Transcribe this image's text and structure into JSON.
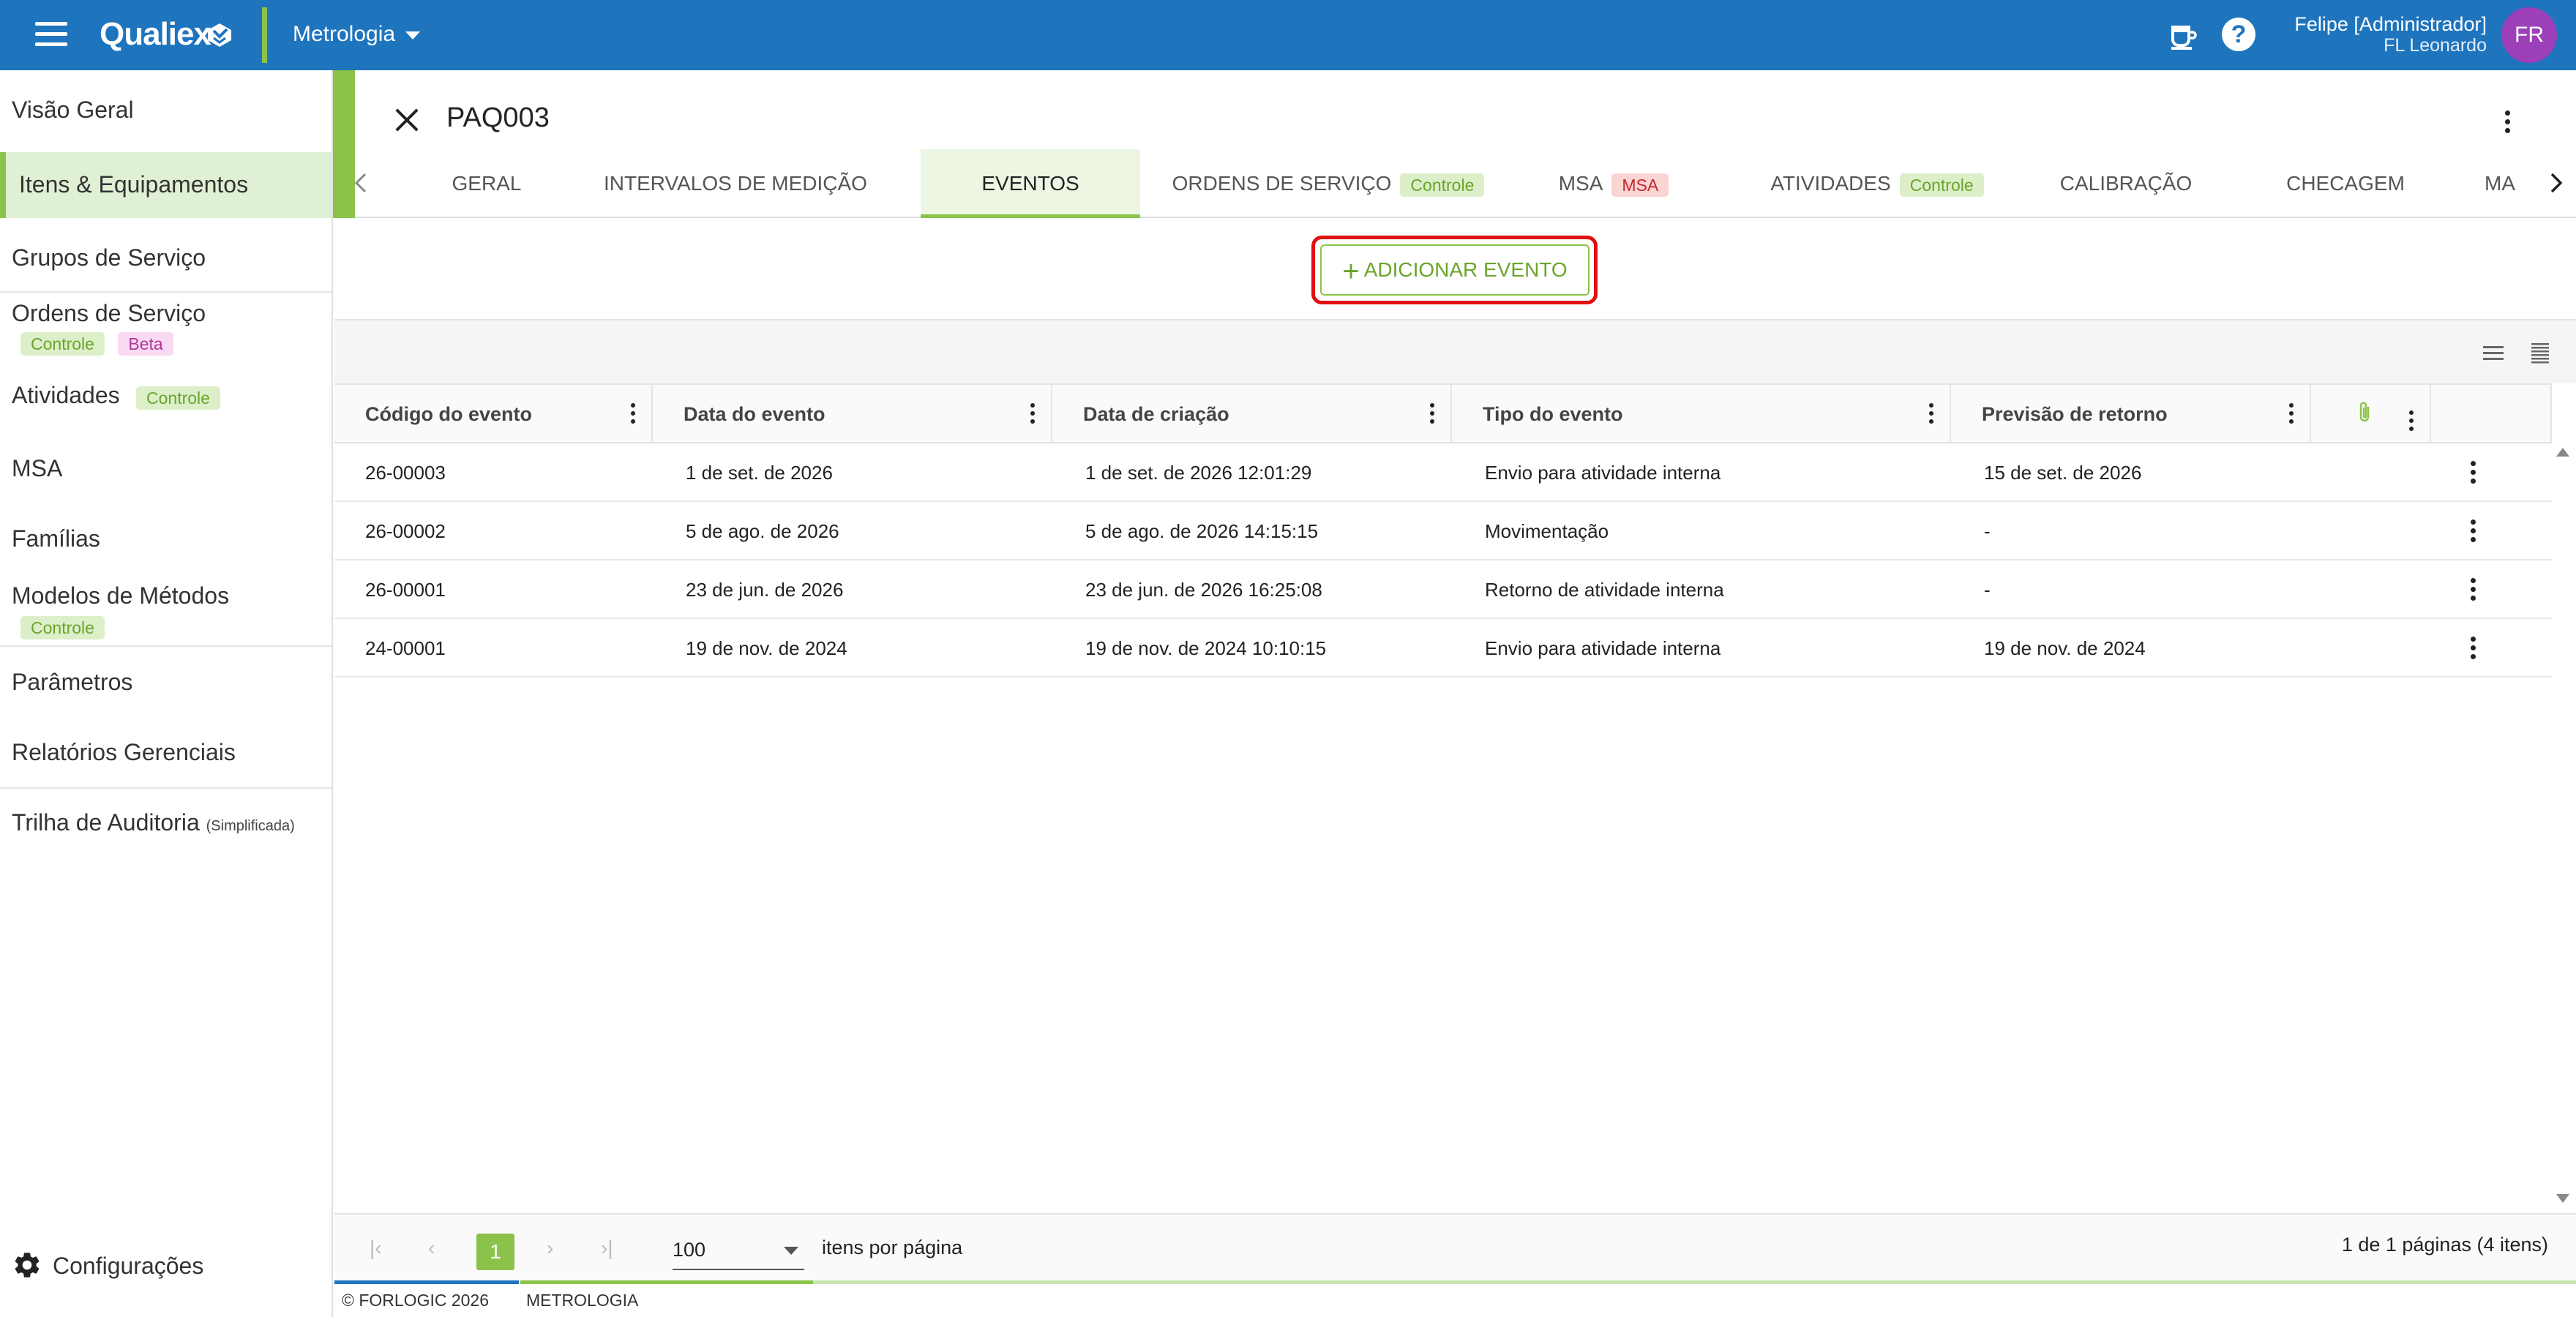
{
  "topbar": {
    "brand": "Qualiex",
    "module": "Metrologia",
    "user_name": "Felipe [Administrador]",
    "user_org": "FL Leonardo",
    "avatar_initials": "FR",
    "help_glyph": "?",
    "colors": {
      "bar": "#1e74bd",
      "accent": "#8bc34a",
      "avatar": "#9c3fb8"
    }
  },
  "sidebar": {
    "items": [
      {
        "label": "Visão Geral"
      },
      {
        "label": "Itens & Equipamentos"
      },
      {
        "label": "Grupos de Serviço"
      },
      {
        "label": "Ordens de Serviço",
        "badges": [
          "Controle",
          "Beta"
        ]
      },
      {
        "label": "Atividades",
        "badges": [
          "Controle"
        ]
      },
      {
        "label": "MSA"
      },
      {
        "label": "Famílias"
      },
      {
        "label": "Modelos de Métodos",
        "badges": [
          "Controle"
        ]
      },
      {
        "label": "Parâmetros"
      },
      {
        "label": "Relatórios Gerenciais"
      },
      {
        "label": "Trilha de Auditoria",
        "note": "(Simplificada)"
      }
    ],
    "config_label": "Configurações"
  },
  "detail": {
    "title": "PAQ003",
    "tabs": [
      {
        "label": "GERAL"
      },
      {
        "label": "INTERVALOS DE MEDIÇÃO"
      },
      {
        "label": "EVENTOS"
      },
      {
        "label": "ORDENS DE SERVIÇO",
        "badge": "Controle"
      },
      {
        "label": "MSA",
        "badge": "MSA"
      },
      {
        "label": "ATIVIDADES",
        "badge": "Controle"
      },
      {
        "label": "CALIBRAÇÃO"
      },
      {
        "label": "CHECAGEM"
      },
      {
        "label": "MA"
      }
    ],
    "add_button": "ADICIONAR EVENTO"
  },
  "table": {
    "columns": [
      "Código do evento",
      "Data do evento",
      "Data de criação",
      "Tipo do evento",
      "Previsão de retorno"
    ],
    "rows": [
      {
        "code": "26-00003",
        "event_date": "1 de set. de 2026",
        "created": "1 de set. de 2026 12:01:29",
        "type": "Envio para atividade interna",
        "return": "15 de set. de 2026"
      },
      {
        "code": "26-00002",
        "event_date": "5 de ago. de 2026",
        "created": "5 de ago. de 2026 14:15:15",
        "type": "Movimentação",
        "return": "-"
      },
      {
        "code": "26-00001",
        "event_date": "23 de jun. de 2026",
        "created": "23 de jun. de 2026 16:25:08",
        "type": "Retorno de atividade interna",
        "return": "-"
      },
      {
        "code": "24-00001",
        "event_date": "19 de nov. de 2024",
        "created": "19 de nov. de 2024 10:10:15",
        "type": "Envio para atividade interna",
        "return": "19 de nov. de 2024"
      }
    ]
  },
  "pager": {
    "current_page": "1",
    "page_size": "100",
    "page_size_label": "itens por página",
    "info": "1 de 1 páginas (4 itens)"
  },
  "footer": {
    "copyright": "© FORLOGIC 2026",
    "module": "METROLOGIA"
  }
}
